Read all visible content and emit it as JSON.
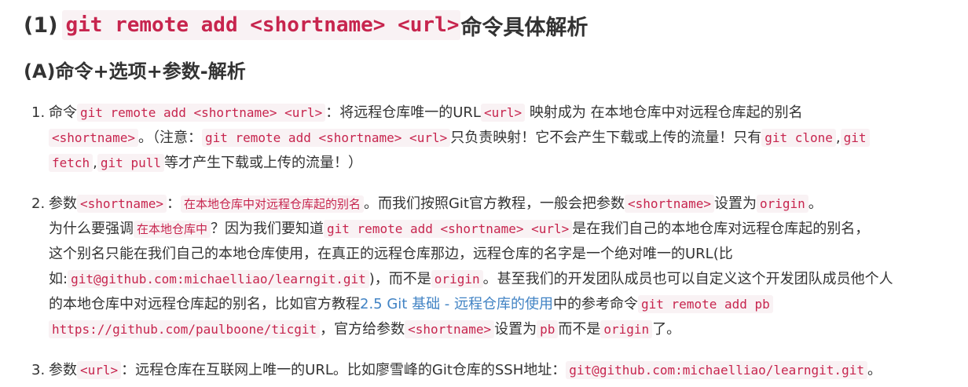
{
  "heading": {
    "prefix": "(1)",
    "code": "git remote add <shortname> <url>",
    "suffix": "命令具体解析"
  },
  "subheading": "(A)命令+选项+参数-解析",
  "items": [
    {
      "num": "1.",
      "l1": {
        "t0": "命令",
        "c1": "git remote add <shortname> <url>",
        "t1": "：将远程仓库唯一的URL",
        "c2": "<url>",
        "t2": " 映射成为 在本地仓库中对远程仓库起的别名"
      },
      "l2": {
        "c1": "<shortname>",
        "t1": "。（注意：",
        "c2": "git remote add <shortname> <url>",
        "t2": "只负责映射！它不会产生下载或上传的流量！只有",
        "c3": "git clone",
        "t3": ",",
        "c4": "git"
      },
      "l3": {
        "c1": "fetch",
        "t1": ",",
        "c2": "git pull",
        "t2": "等才产生下载或上传的流量！）"
      }
    },
    {
      "num": "2.",
      "l1": {
        "t0": "参数",
        "c1": "<shortname>",
        "t1": "：",
        "s1": "在本地仓库中对远程仓库起的别名",
        "t2": "。而我们按照Git官方教程，一般会把参数",
        "c2": "<shortname>",
        "t3": "设置为",
        "c3": "origin",
        "t4": "。"
      },
      "l2": {
        "t0": "为什么要强调",
        "s1": "在本地仓库中",
        "t1": "？因为我们要知道",
        "c1": "git remote add <shortname> <url>",
        "t2": "是在我们自己的本地仓库对远程仓库起的别名，"
      },
      "l3": {
        "t0": "这个别名只能在我们自己的本地仓库使用，在真正的远程仓库那边，远程仓库的名字是一个绝对唯一的URL(比"
      },
      "l4": {
        "t0": "如:",
        "c1": "git@github.com:michaelliao/learngit.git",
        "t1": ")，而不是",
        "c2": "origin",
        "t2": "。甚至我们的开发团队成员也可以自定义这个开发团队成员他个人"
      },
      "l5": {
        "t0": "的本地仓库中对远程仓库起的别名，比如官方教程",
        "link": "2.5 Git 基础 - 远程仓库的使用",
        "t1": "中的参考命令",
        "c1": "git remote add pb"
      },
      "l6": {
        "c1": "https://github.com/paulboone/ticgit",
        "t1": "，官方给参数",
        "c2": "<shortname>",
        "t2": "设置为",
        "c3": "pb",
        "t3": "而不是",
        "c4": "origin",
        "t4": "了。"
      }
    },
    {
      "num": "3.",
      "l1": {
        "t0": "参数",
        "c1": "<url>",
        "t1": "：远程仓库在互联网上唯一的URL。比如廖雪峰的Git仓库的SSH地址：",
        "c2": "git@github.com:michaelliao/learngit.git",
        "t2": "。"
      }
    }
  ]
}
